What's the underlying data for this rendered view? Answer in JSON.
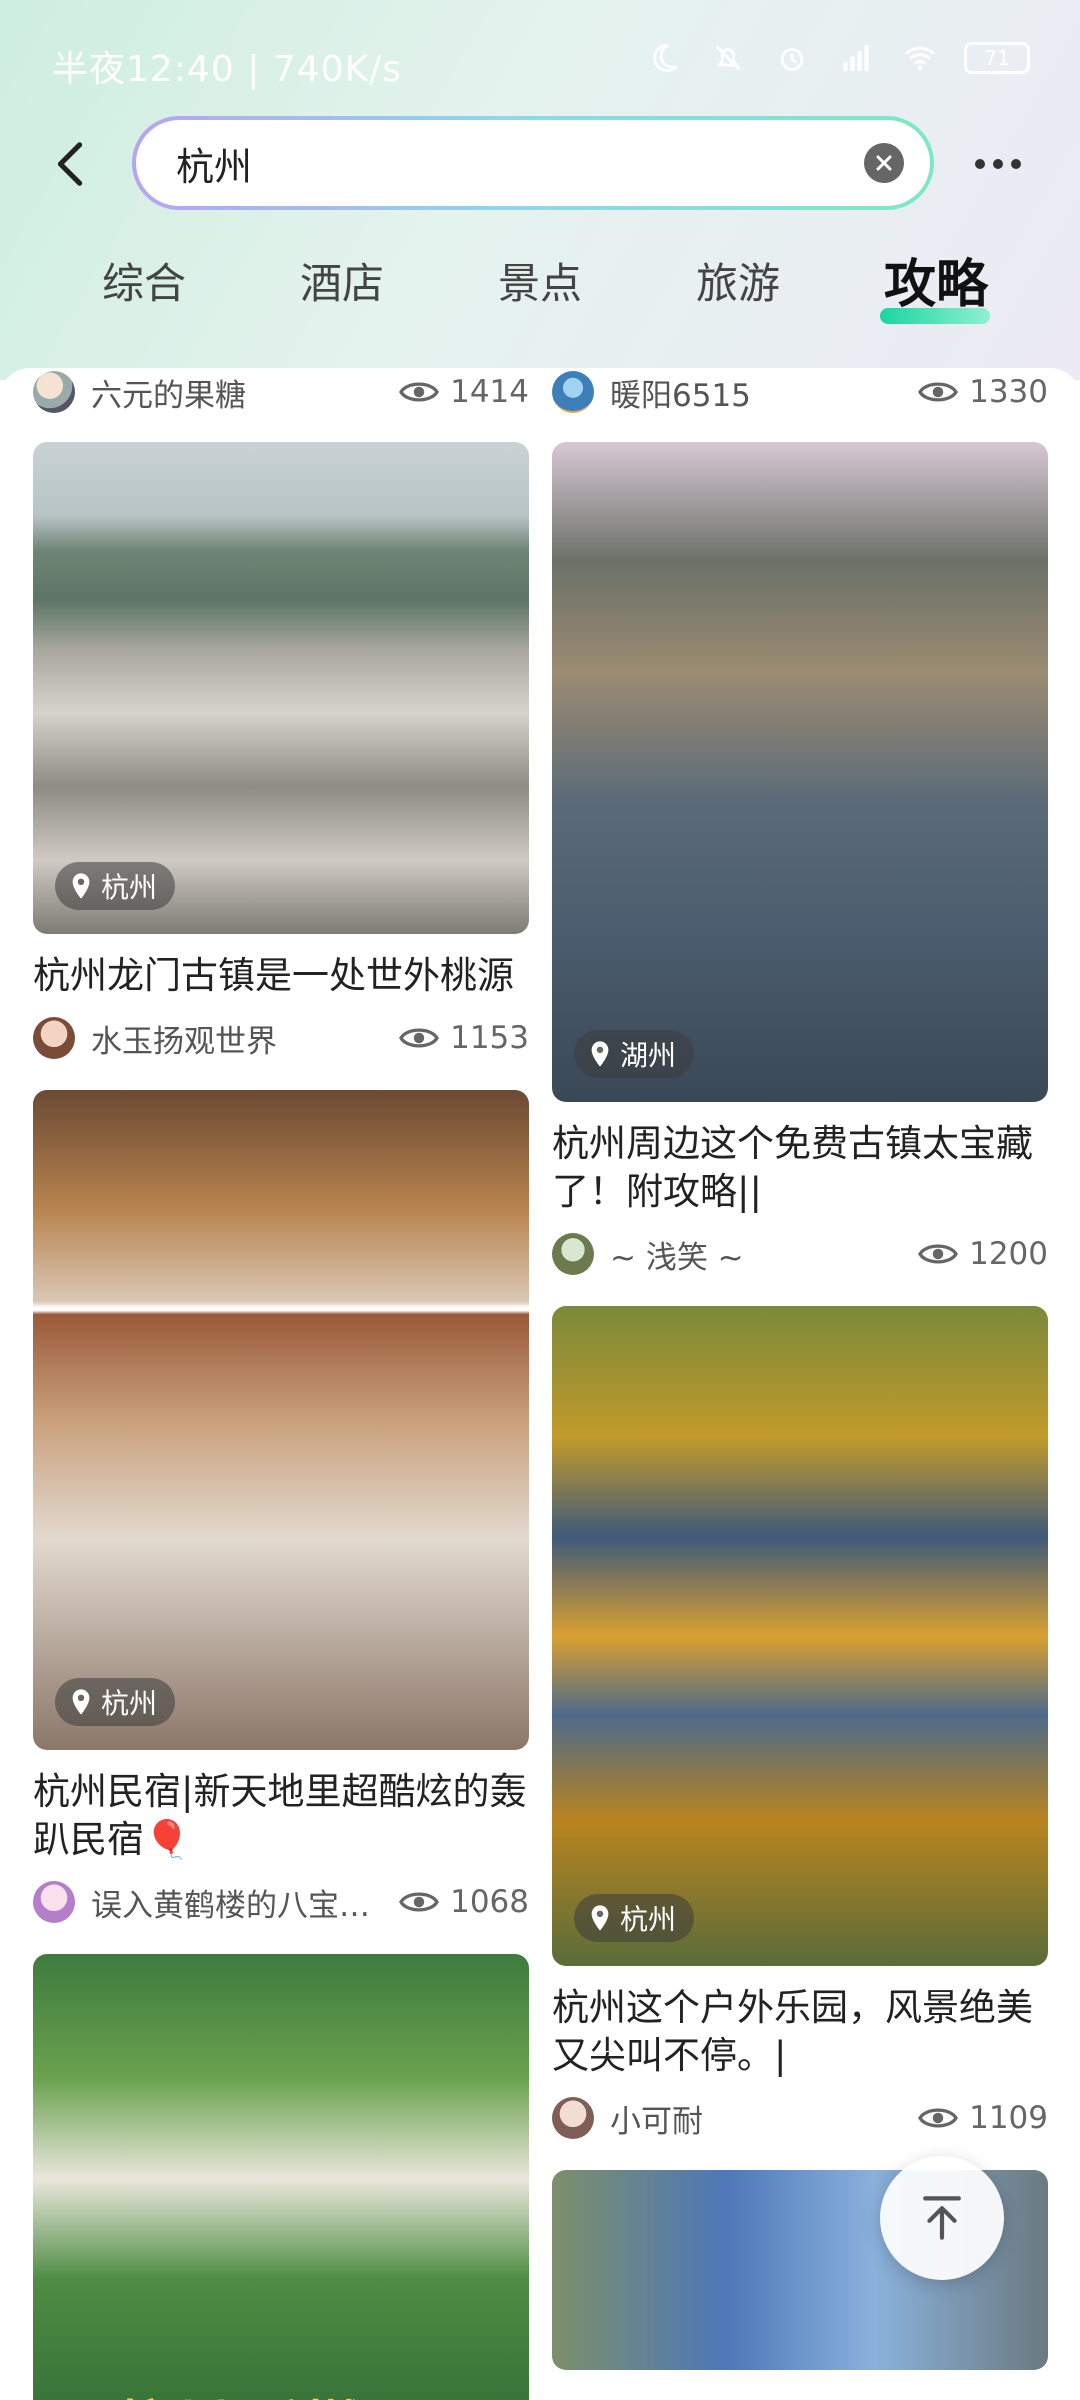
{
  "status_bar": {
    "text": "半夜12:40 | 740K/s",
    "battery": "71"
  },
  "search": {
    "value": "杭州"
  },
  "tabs": [
    {
      "label": "综合"
    },
    {
      "label": "酒店"
    },
    {
      "label": "景点"
    },
    {
      "label": "旅游"
    },
    {
      "label": "攻略"
    }
  ],
  "active_tab": "攻略",
  "feed": {
    "left": {
      "top_meta": {
        "author": "六元的果糖",
        "views": "1414"
      },
      "cards": [
        {
          "location": "杭州",
          "title": "杭州龙门古镇是一处世外桃源",
          "author": "水玉扬观世界",
          "views": "1153"
        },
        {
          "location": "杭州",
          "title": "杭州民宿|新天地里超酷炫的轰趴民宿🎈",
          "author": "误入黄鹤楼的八宝…",
          "views": "1068"
        },
        {
          "image_text": "杭州·香樾里"
        }
      ]
    },
    "right": {
      "top_meta": {
        "author": "暖阳6515",
        "views": "1330"
      },
      "cards": [
        {
          "location": "湖州",
          "title": "杭州周边这个免费古镇太宝藏了！附攻略||",
          "author": "~ 浅笑 ~",
          "views": "1200"
        },
        {
          "location": "杭州",
          "title": "杭州这个户外乐园，风景绝美又尖叫不停。|",
          "author": "小可耐",
          "views": "1109"
        }
      ]
    }
  },
  "colors": {
    "accent_gradient_start": "#1ad6a0",
    "search_border_start": "#b7a4f3",
    "search_border_end": "#7ee8c4"
  }
}
